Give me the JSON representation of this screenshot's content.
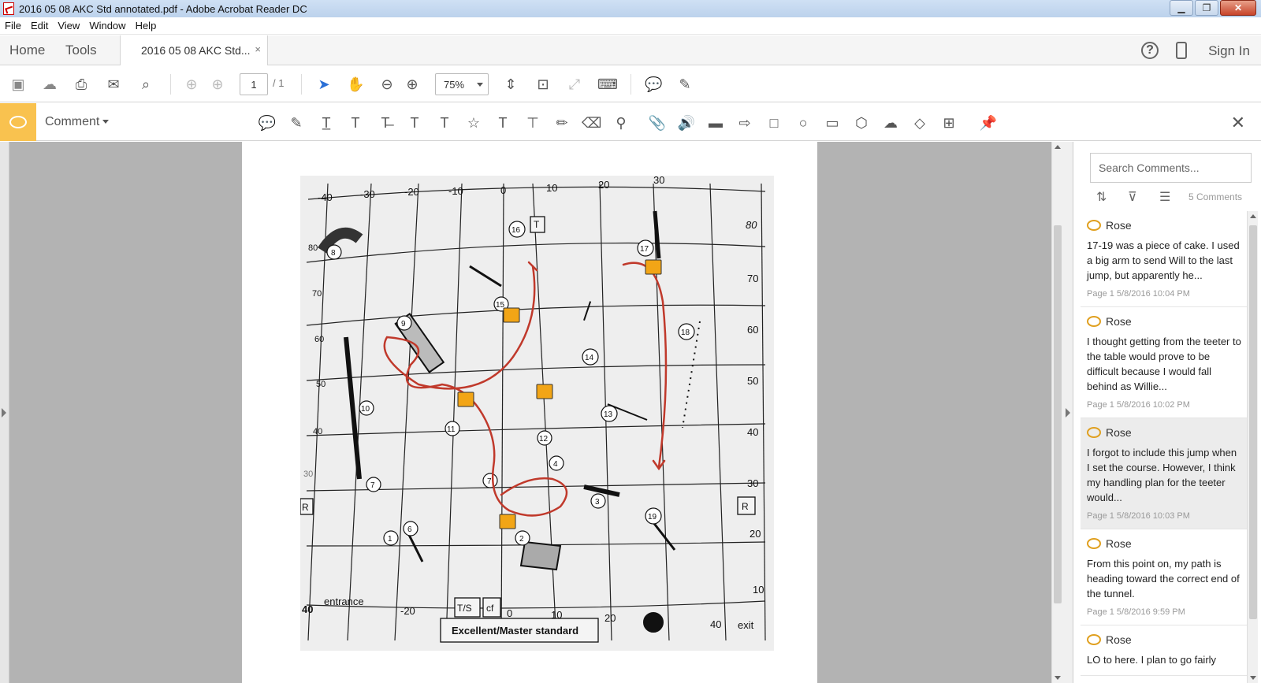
{
  "window": {
    "title": "2016 05 08 AKC Std annotated.pdf - Adobe Acrobat Reader DC"
  },
  "menu": [
    "File",
    "Edit",
    "View",
    "Window",
    "Help"
  ],
  "tabs": {
    "home": "Home",
    "tools": "Tools",
    "doc": "2016 05 08 AKC Std...",
    "close": "×",
    "signin": "Sign In"
  },
  "toolbar": {
    "page": "1",
    "page_total": "/ 1",
    "zoom": "75%"
  },
  "comment_bar": {
    "label": "Comment"
  },
  "panel": {
    "search_placeholder": "Search Comments...",
    "count": "5 Comments",
    "comments": [
      {
        "author": "Rose",
        "text": "17-19 was a piece of cake.  I used a big arm to send Will to the last jump, but apparently he...",
        "meta": "Page 1  5/8/2016  10:04 PM"
      },
      {
        "author": "Rose",
        "text": "I thought getting from the teeter to the table would prove to be difficult because I would fall behind as Willie...",
        "meta": "Page 1  5/8/2016  10:02 PM"
      },
      {
        "author": "Rose",
        "text": "I forgot to include this jump when I set the course. However, I think my handling plan for the teeter would...",
        "meta": "Page 1  5/8/2016  10:03 PM"
      },
      {
        "author": "Rose",
        "text": "From this point on, my path is heading toward the correct end of the tunnel.",
        "meta": "Page 1  5/8/2016  9:59 PM"
      },
      {
        "author": "Rose",
        "text": "LO to here.  I plan to go fairly",
        "meta": ""
      }
    ]
  },
  "course_map": {
    "top_ticks": [
      "-40",
      "-30",
      "-20",
      "-10",
      "0",
      "10",
      "20",
      "30"
    ],
    "bottom_ticks": [
      "-20",
      "0",
      "10",
      "20",
      "40"
    ],
    "left_ticks": [
      "80",
      "70",
      "60",
      "50",
      "40",
      "30"
    ],
    "right_ticks": [
      "80",
      "70",
      "60",
      "50",
      "40",
      "30",
      "20",
      "10"
    ],
    "labels": {
      "entrance": "entrance",
      "exit": "exit",
      "footer": "Excellent/Master standard",
      "ts": "T/S",
      "cf": "cf",
      "r": "R",
      "bottom_left": "40",
      "table": "T"
    },
    "obstacles": [
      "1",
      "2",
      "3",
      "4",
      "6",
      "7",
      "8",
      "9",
      "10",
      "11",
      "12",
      "13",
      "14",
      "15",
      "16",
      "17",
      "18",
      "19"
    ]
  }
}
